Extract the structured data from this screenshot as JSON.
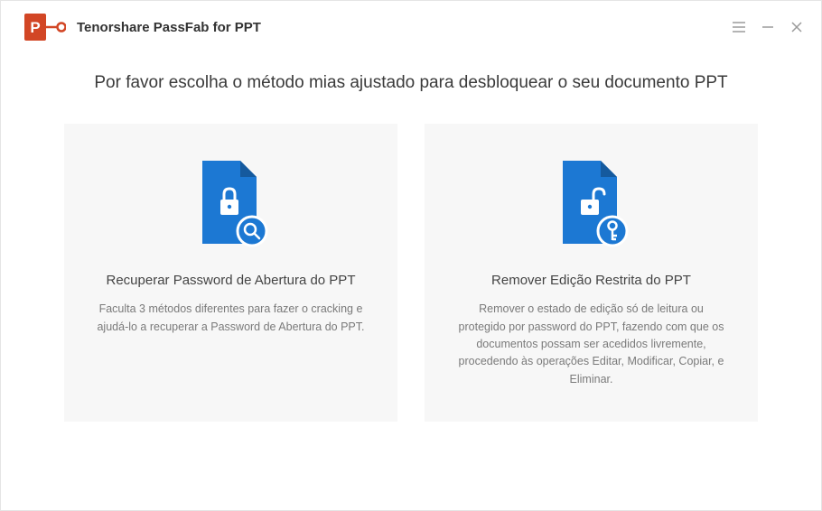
{
  "app": {
    "title": "Tenorshare PassFab for PPT"
  },
  "heading": "Por favor escolha o método mias ajustado para desbloquear o seu documento PPT",
  "options": {
    "recover": {
      "title": "Recuperar Password de Abertura do PPT",
      "desc": "Faculta 3 métodos diferentes para fazer o cracking e ajudá-lo a recuperar a Password de Abertura do PPT."
    },
    "remove": {
      "title": "Remover Edição Restrita do PPT",
      "desc": "Remover o estado de edição só de leitura ou protegido por password do PPT, fazendo com que os documentos possam ser acedidos livremente, procedendo às operações Editar, Modificar, Copiar, e Eliminar."
    }
  },
  "colors": {
    "brand_orange": "#d24625",
    "accent_blue": "#1c78d3"
  }
}
